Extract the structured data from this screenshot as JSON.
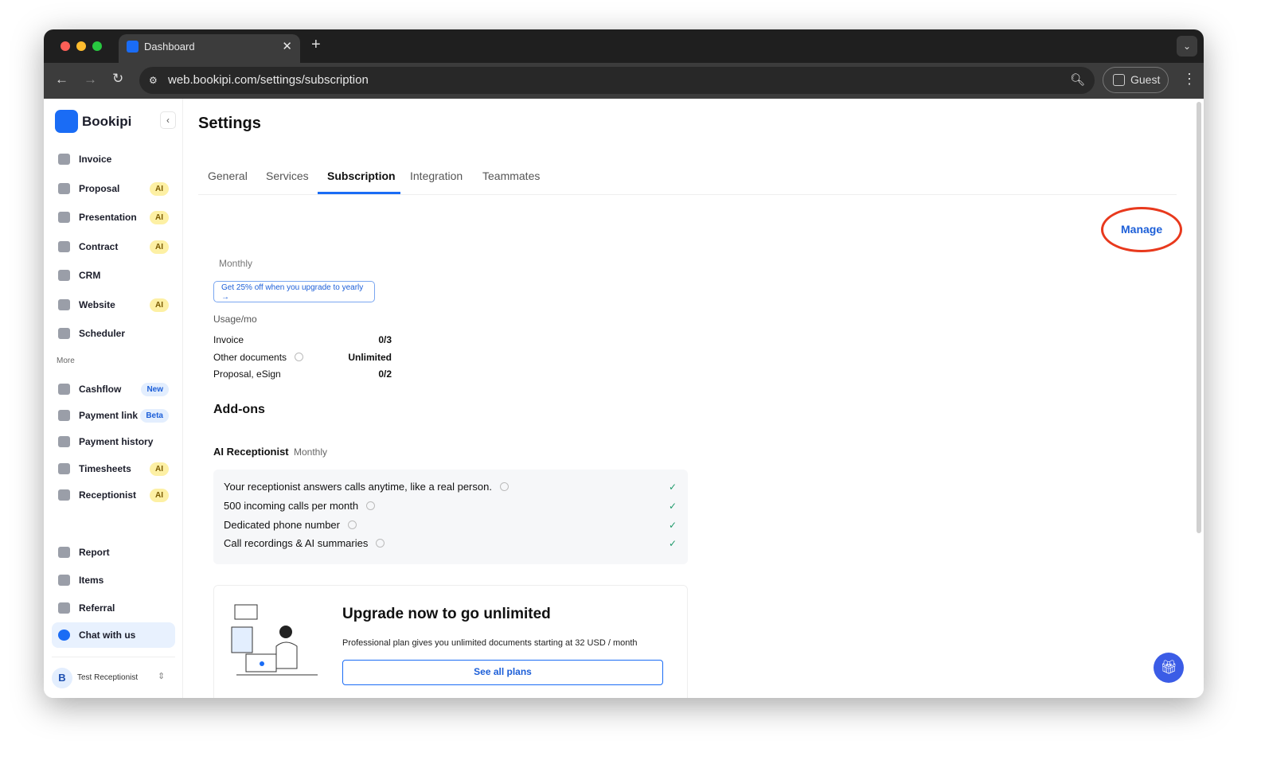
{
  "browser": {
    "tab_title": "Dashboard",
    "url": "web.bookipi.com/settings/subscription",
    "profile": "Guest"
  },
  "sidebar": {
    "brand": "Bookipi",
    "items": [
      {
        "label": "Invoice"
      },
      {
        "label": "Proposal",
        "badge": "AI"
      },
      {
        "label": "Presentation",
        "badge": "AI"
      },
      {
        "label": "Contract",
        "badge": "AI"
      },
      {
        "label": "CRM"
      },
      {
        "label": "Website",
        "badge": "AI"
      },
      {
        "label": "Scheduler"
      }
    ],
    "more_label": "More",
    "more_items": [
      {
        "label": "Cashflow",
        "badge": "New"
      },
      {
        "label": "Payment link",
        "badge": "Beta"
      },
      {
        "label": "Payment history"
      },
      {
        "label": "Timesheets",
        "badge": "AI"
      },
      {
        "label": "Receptionist",
        "badge": "AI"
      }
    ],
    "bottom_items": [
      {
        "label": "Report"
      },
      {
        "label": "Items"
      },
      {
        "label": "Referral"
      },
      {
        "label": "Chat with us"
      }
    ],
    "user": {
      "initial": "B",
      "name": "Test Receptionist"
    }
  },
  "main": {
    "title": "Settings",
    "tabs": [
      "General",
      "Services",
      "Subscription",
      "Integration",
      "Teammates"
    ],
    "active_tab": "Subscription",
    "plan_period": "Monthly",
    "promo": "Get 25% off when you upgrade to yearly",
    "promo_arrow": "→",
    "manage": "Manage",
    "usage_label": "Usage/mo",
    "usage": [
      {
        "label": "Invoice",
        "value": "0/3"
      },
      {
        "label": "Other documents",
        "value": "Unlimited"
      },
      {
        "label": "Proposal, eSign",
        "value": "0/2"
      }
    ],
    "addons_title": "Add-ons",
    "addon_name": "AI Receptionist",
    "addon_period": "Monthly",
    "features": [
      "Your receptionist answers calls anytime, like a real person.",
      "500 incoming calls per month",
      "Dedicated phone number",
      "Call recordings & AI summaries"
    ],
    "upgrade": {
      "title": "Upgrade now to go unlimited",
      "text": "Professional plan gives you unlimited documents starting at 32 USD / month",
      "button": "See all plans"
    }
  },
  "colors": {
    "accent": "#1d5fd8",
    "annotation": "#e8391d"
  }
}
